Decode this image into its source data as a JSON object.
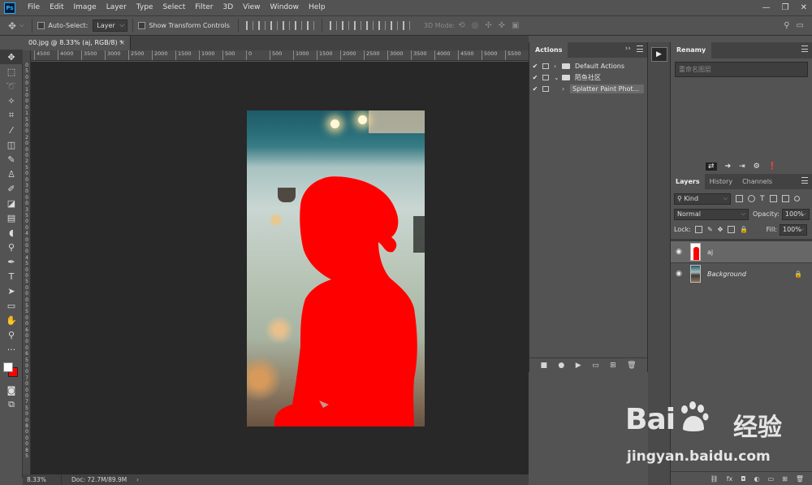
{
  "app": {
    "logo": "Ps"
  },
  "menubar": {
    "items": [
      "File",
      "Edit",
      "Image",
      "Layer",
      "Type",
      "Select",
      "Filter",
      "3D",
      "View",
      "Window",
      "Help"
    ],
    "window_controls": [
      "—",
      "❐",
      "✕"
    ]
  },
  "options_bar": {
    "move_icon": "move-icon",
    "auto_select_label": "Auto-Select:",
    "auto_select_value": "Layer",
    "show_transform_label": "Show Transform Controls",
    "mode_3d_label": "3D Mode:"
  },
  "document": {
    "tab_title": "00.jpg @ 8.33% (aj, RGB/8) *",
    "close_glyph": "×",
    "ruler_top": [
      "4500",
      "4000",
      "3500",
      "3000",
      "2500",
      "2000",
      "1500",
      "1000",
      "500",
      "0",
      "500",
      "1000",
      "1500",
      "2000",
      "2500",
      "3000",
      "3500",
      "4000",
      "4500",
      "5000",
      "5500",
      "6000"
    ],
    "ruler_left": [
      "0",
      "5",
      "0",
      "0",
      "1",
      "0",
      "0",
      "0",
      "1",
      "5",
      "0",
      "0",
      "2",
      "0",
      "0",
      "0",
      "2",
      "5",
      "0",
      "0",
      "3",
      "0",
      "0",
      "0",
      "3",
      "5",
      "0",
      "0",
      "4",
      "0",
      "0",
      "0",
      "4",
      "5",
      "0",
      "0",
      "5",
      "0",
      "0",
      "0",
      "5",
      "5",
      "0",
      "0",
      "6",
      "0",
      "0",
      "0",
      "6",
      "5",
      "0",
      "0",
      "7",
      "0",
      "0",
      "0",
      "7",
      "5",
      "0",
      "0",
      "8",
      "0",
      "0",
      "0",
      "8",
      "5"
    ],
    "status_zoom": "8.33%",
    "status_doc": "Doc: 72.7M/89.9M",
    "status_arrow": "›"
  },
  "colors": {
    "foreground": "#ffffff",
    "background": "#ff0000",
    "mask": "#ff0000"
  },
  "actions_panel": {
    "tab": "Actions",
    "collapse": "››",
    "rows": [
      {
        "check": "✔",
        "label": "Default Actions",
        "arrow": "›",
        "type": "set"
      },
      {
        "check": "✔",
        "label": "陌鱼社区",
        "arrow": "⌄",
        "type": "set"
      },
      {
        "check": "✔",
        "label": "Splatter Paint Phot...",
        "arrow": "›",
        "type": "action"
      }
    ],
    "footer_icons": [
      "stop-icon",
      "record-icon",
      "play-icon",
      "folder-icon",
      "new-action-icon",
      "delete-icon"
    ],
    "footer_glyphs": [
      "■",
      "●",
      "▶",
      "▭",
      "⊞",
      "🗑"
    ],
    "play_strip_glyph": "▶"
  },
  "renamy_panel": {
    "tab": "Renamy",
    "input_placeholder": "重命名图层",
    "toolbar_glyphs": [
      "⇄",
      "➔",
      "⇥",
      "⚙",
      "❗"
    ]
  },
  "layers_panel": {
    "tabs": [
      "Layers",
      "History",
      "Channels"
    ],
    "filter_kind": "Kind",
    "blend_mode": "Normal",
    "opacity_label": "Opacity:",
    "opacity_value": "100%",
    "lock_label": "Lock:",
    "fill_label": "Fill:",
    "fill_value": "100%",
    "layers": [
      {
        "name": "aj",
        "visible": true,
        "selected": true,
        "thumbnail": "mask"
      },
      {
        "name": "Background",
        "visible": true,
        "selected": false,
        "locked": true,
        "thumbnail": "photo"
      }
    ],
    "footer_glyphs": [
      "⛓",
      "fx",
      "◘",
      "◐",
      "▭",
      "⊞",
      "🗑"
    ]
  },
  "watermark": {
    "brand": "Bai",
    "brand_cn": "经验",
    "url": "jingyan.baidu.com"
  }
}
